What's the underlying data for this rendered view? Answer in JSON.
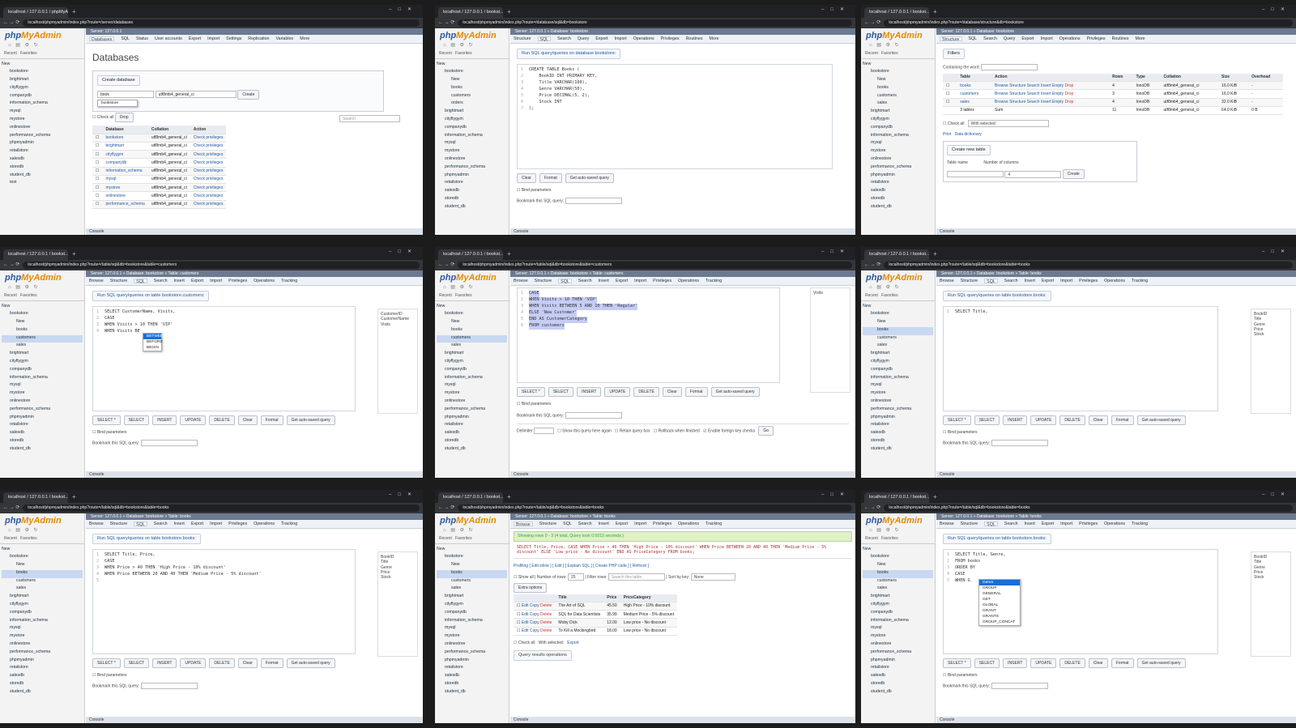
{
  "tabs": {
    "t1": "localhost / 127.0.0.1 / phpMyAdmin",
    "t2": "localhost / 127.0.0.1 / bookst...",
    "t3": "localhost / 127.0.0.1 / bookst..."
  },
  "urls": {
    "databases": "localhost/phpmyadmin/index.php?route=/server/databases",
    "sql_db": "localhost/phpmyadmin/index.php?route=/database/sql&db=bookstore",
    "structure_db": "localhost/phpmyadmin/index.php?route=/database/structure&db=bookstore",
    "sql_customers": "localhost/phpmyadmin/index.php?route=/table/sql&db=bookstore&table=customers",
    "sql_books": "localhost/phpmyadmin/index.php?route=/table/sql&db=bookstore&table=books"
  },
  "brand": {
    "php": "php",
    "myadmin": "MyAdmin",
    "recent": "Recent",
    "favorites": "Favorites",
    "new": "New",
    "console": "Console"
  },
  "server_bar": {
    "server": "Server: 127.0.0.1",
    "db": "Server: 127.0.0.1 » Database: bookstore",
    "customers": "Server: 127.0.0.1 » Database: bookstore » Table: customers",
    "books": "Server: 127.0.0.1 » Database: bookstore » Table: books"
  },
  "menus": {
    "server": [
      "Databases",
      "SQL",
      "Status",
      "User accounts",
      "Export",
      "Import",
      "Settings",
      "Replication",
      "Variables",
      "More"
    ],
    "database": [
      "Structure",
      "SQL",
      "Search",
      "Query",
      "Export",
      "Import",
      "Operations",
      "Privileges",
      "Routines",
      "More"
    ],
    "table": [
      "Browse",
      "Structure",
      "SQL",
      "Search",
      "Insert",
      "Export",
      "Import",
      "Privileges",
      "Operations",
      "Tracking"
    ]
  },
  "tree": {
    "databases": [
      "bookstore",
      "brightmart",
      "cityflygym",
      "companydb",
      "information_schema",
      "mysql",
      "mystore",
      "onlinestore",
      "performance_schema",
      "phpmyadmin",
      "retailstore",
      "salesdb",
      "storedb",
      "student_db",
      "test"
    ],
    "bookstore_tables": [
      "New",
      "books",
      "customers",
      "orders"
    ],
    "bookstore_tables_sales": [
      "New",
      "books",
      "customers",
      "sales"
    ]
  },
  "p1": {
    "title": "Databases",
    "create_label": "Create database",
    "db_input": "book",
    "collation": "utf8mb4_general_ci",
    "create_btn": "Create",
    "suggestion": "bookstore",
    "check_all": "Check all",
    "drop": "Drop",
    "search_placeholder": "Search",
    "headers": [
      "Database",
      "Collation",
      "Action"
    ],
    "rows": [
      [
        "bookstore",
        "utf8mb4_general_ci",
        "Check privileges"
      ],
      [
        "brightmart",
        "utf8mb4_general_ci",
        "Check privileges"
      ],
      [
        "cityflygym",
        "utf8mb4_general_ci",
        "Check privileges"
      ],
      [
        "companydb",
        "utf8mb4_general_ci",
        "Check privileges"
      ],
      [
        "information_schema",
        "utf8mb4_general_ci",
        "Check privileges"
      ],
      [
        "mysql",
        "utf8mb4_general_ci",
        "Check privileges"
      ],
      [
        "mystore",
        "utf8mb4_general_ci",
        "Check privileges"
      ],
      [
        "onlinestore",
        "utf8mb4_general_ci",
        "Check privileges"
      ],
      [
        "performance_schema",
        "utf8mb4_general_ci",
        "Check privileges"
      ]
    ]
  },
  "p2": {
    "header_prefix": "Run SQL query/queries on database ",
    "header_db": "bookstore:",
    "lines": [
      "CREATE TABLE Books (",
      "    BookID INT PRIMARY KEY,",
      "    Title VARCHAR(100),",
      "    Genre VARCHAR(50),",
      "    Price DECIMAL(5, 2),",
      "    Stock INT",
      ");"
    ],
    "buttons": [
      "Clear",
      "Format",
      "Get auto-saved query"
    ],
    "bind_params": "Bind parameters",
    "bookmark": "Bookmark this SQL query:"
  },
  "p3": {
    "filters": "Filters",
    "containing": "Containing the word:",
    "headers": [
      "Table",
      "Action",
      "Rows",
      "Type",
      "Collation",
      "Size",
      "Overhead"
    ],
    "actions": [
      "Browse",
      "Structure",
      "Search",
      "Insert",
      "Empty",
      "Drop"
    ],
    "rows": [
      [
        "books",
        "4",
        "InnoDB",
        "utf8mb4_general_ci",
        "16.0 KiB",
        "-"
      ],
      [
        "customers",
        "3",
        "InnoDB",
        "utf8mb4_general_ci",
        "16.0 KiB",
        "-"
      ],
      [
        "sales",
        "4",
        "InnoDB",
        "utf8mb4_general_ci",
        "32.0 KiB",
        "-"
      ]
    ],
    "sum": [
      "3 tables",
      "Sum",
      "11",
      "InnoDB",
      "utf8mb4_general_ci",
      "64.0 KiB",
      "0 B"
    ],
    "check_all": "Check all",
    "with_selected": "With selected:",
    "print": "Print",
    "data_dict": "Data dictionary",
    "create_table": "Create new table",
    "table_name": "Table name",
    "num_cols": "Number of columns",
    "num_cols_val": "4",
    "create_btn": "Create"
  },
  "p4": {
    "header_prefix": "Run SQL query/queries on table ",
    "header_table": "bookstore.customers:",
    "lines": [
      "SELECT CustomerName, Visits,",
      "CASE",
      "WHEN Visits > 10 THEN 'VIP'",
      "WHEN Visits BE"
    ],
    "ac": [
      "BETWEEN",
      "BEFORE",
      "BEGIN"
    ],
    "columns": [
      "CustomerID",
      "CustomerName",
      "Visits"
    ],
    "buttons": [
      "SELECT *",
      "SELECT",
      "INSERT",
      "UPDATE",
      "DELETE",
      "Clear",
      "Format",
      "Get auto-saved query"
    ]
  },
  "p5": {
    "lines": [
      "CASE",
      "WHEN Visits > 10 THEN 'VIP'",
      "WHEN Visits BETWEEN 5 AND 10 THEN 'Regular'",
      "ELSE 'New Customer'",
      "END AS CustomerCategory",
      "FROM customers"
    ],
    "columns_label": "Visits",
    "buttons": [
      "SELECT *",
      "SELECT",
      "INSERT",
      "UPDATE",
      "DELETE",
      "Clear",
      "Format",
      "Get auto-saved query"
    ],
    "delimiter": "Delimiter",
    "show_again": "Show this query here again",
    "retain": "Retain query box",
    "rollback": "Rollback when finished",
    "fk": "Enable foreign key checks",
    "go": "Go"
  },
  "p6": {
    "header_table": "bookstore.books:",
    "lines": [
      "SELECT Title,"
    ],
    "columns": [
      "BookID",
      "Title",
      "Genre",
      "Price",
      "Stock"
    ]
  },
  "p7": {
    "lines": [
      "SELECT Title, Price,",
      "CASE",
      "WHEN Price > 40 THEN 'High Price - 10% discount'",
      "WHEN Price BETWEEN 20 AND 40 THEN 'Medium Price - 5% discount'",
      ""
    ]
  },
  "p8": {
    "success": "Showing rows 0 - 3 (4 total, Query took 0.0015 seconds.)",
    "sql": "SELECT Title, Price, CASE WHEN Price > 40 THEN 'High Price - 10% discount' WHEN Price BETWEEN 20 AND 40 THEN 'Medium Price - 5% discount' ELSE 'Low price - No discount' END AS PriceCategory FROM books;",
    "links": "Profiling [ Edit inline ] [ Edit ] [ Explain SQL ] [ Create PHP code ] [ Refresh ]",
    "show_all": "Show all",
    "num_rows": "Number of rows:",
    "num_rows_val": "25",
    "filter": "Filter rows:",
    "filter_ph": "Search this table",
    "sort": "Sort by key:",
    "sort_val": "None",
    "extra": "Extra options",
    "headers": [
      "Title",
      "Price",
      "PriceCategory"
    ],
    "rows": [
      [
        "The Art of SQL",
        "45.50",
        "High Price - 10% discount"
      ],
      [
        "SQL for Data Scientists",
        "35.99",
        "Medium Price - 5% discount"
      ],
      [
        "Moby Dick",
        "12.00",
        "Low price - No discount"
      ],
      [
        "To Kill a Mockingbird",
        "18.00",
        "Low price - No discount"
      ]
    ],
    "row_actions": [
      "Edit",
      "Copy",
      "Delete"
    ],
    "with_selected": "With selected:",
    "export": "Export",
    "qro": "Query results operations"
  },
  "p9": {
    "lines": [
      "SELECT Title, Genre,",
      "FROM books",
      "ORDER BY",
      "CASE",
      "WHEN G"
    ],
    "ac": [
      "Genre",
      "GROUP",
      "GENERAL",
      "GET",
      "GLOBAL",
      "GRANT",
      "GRANTS",
      "GROUP_CONCAT"
    ]
  },
  "watermark": "Udemy",
  "colors": {
    "accent": "#235a9f",
    "brand_orange": "#e58a00",
    "tab_bg": "#202124"
  }
}
